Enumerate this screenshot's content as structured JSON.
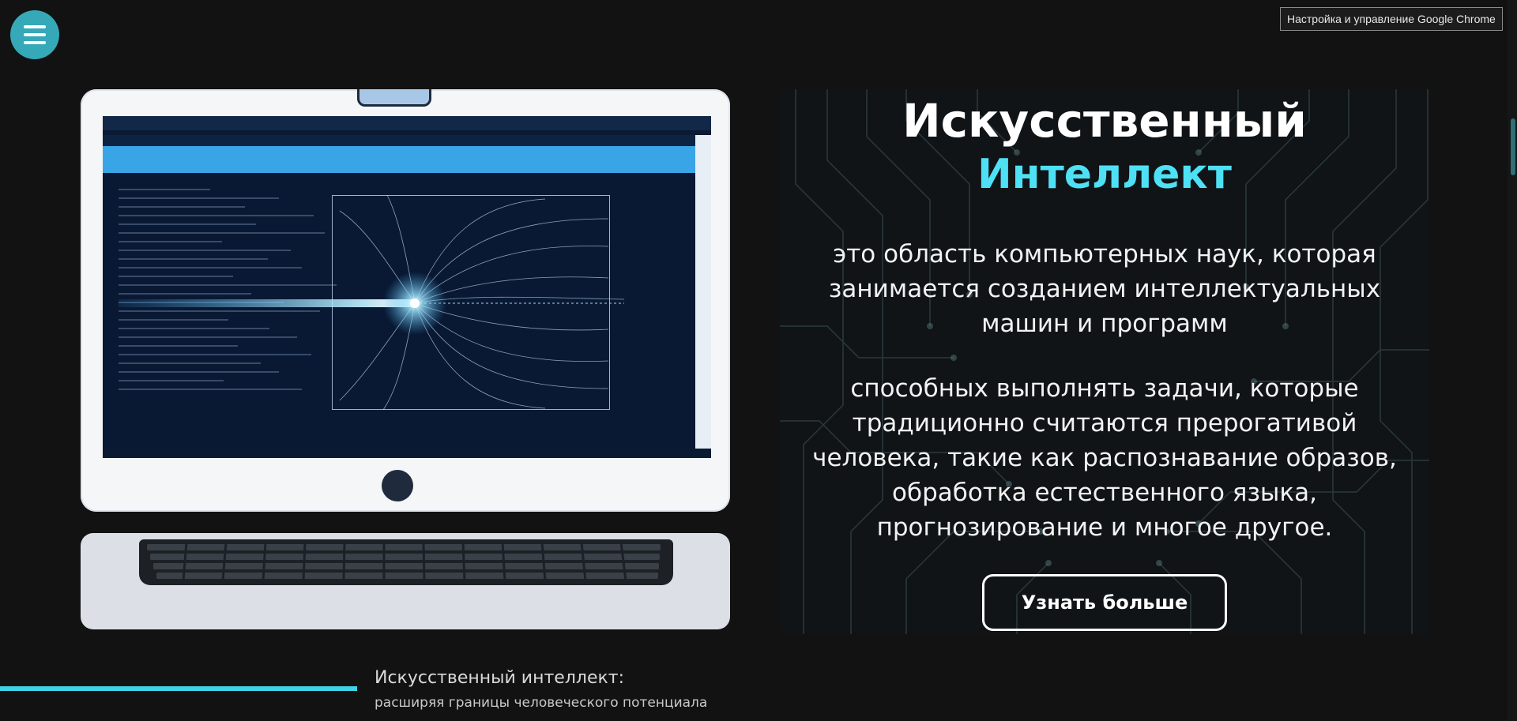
{
  "menu": {
    "icon": "hamburger-menu-icon",
    "color": "#35a9b8"
  },
  "browser": {
    "tooltip": "Настройка и управление Google Chrome"
  },
  "hero": {
    "title_line1": "Искусственный",
    "title_line2": "Интеллект",
    "paragraph1": "это область компьютерных наук, которая занимается созданием интеллектуальных машин и программ",
    "paragraph2": "способных выполнять задачи, которые традиционно считаются прерогативой человека, такие как распознавание образов, обработка естественного языка, прогнозирование и многое другое.",
    "cta_label": "Узнать больше",
    "accent_color": "#4ee1f5"
  },
  "caption": {
    "title": "Искусственный интеллект:",
    "subtitle": "расширяя границы человеческого потенциала",
    "accent_color": "#3fd2e4"
  },
  "illustration": {
    "name": "computer-illustration"
  }
}
